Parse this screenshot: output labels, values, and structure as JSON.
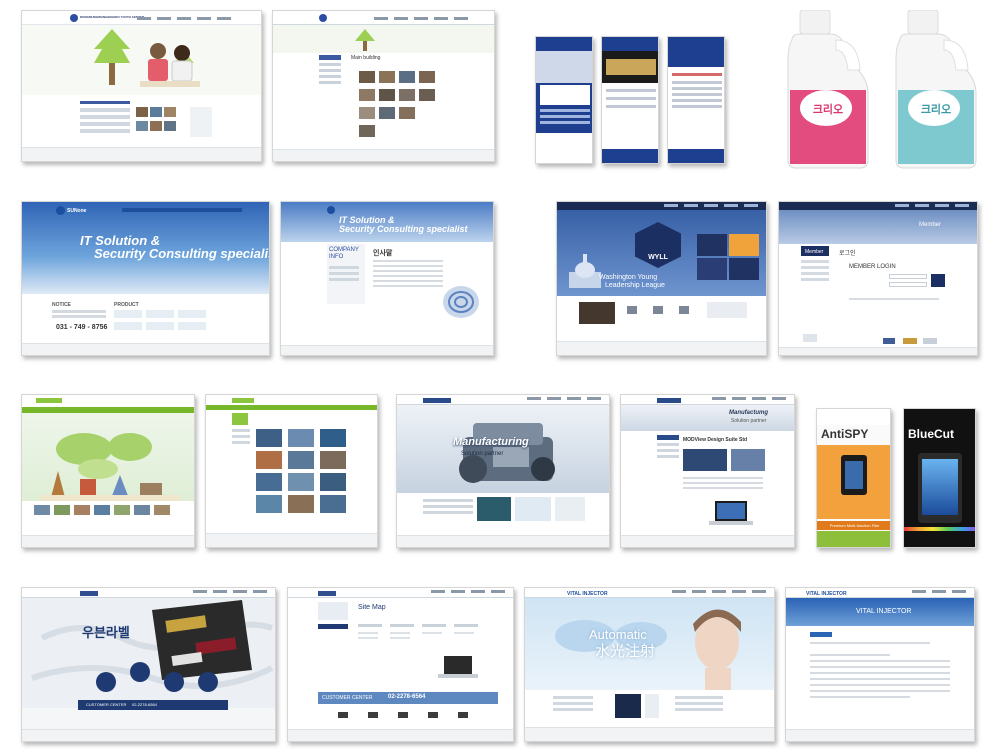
{
  "gallery": {
    "row1": {
      "youth_center_logo": "DONGMUNGWANGBOGIDO YOUTH CENTER",
      "main_building_title": "Main building",
      "laundry_label_pink": "크리오",
      "laundry_label_blue": "크리오"
    },
    "row2": {
      "sunone_logo": "SUNone",
      "it_headline_1": "IT Solution &",
      "it_headline_2": "Security Consulting specialist",
      "notice_label": "NOTICE",
      "product_label": "PRODUCT",
      "phone": "031 - 749 - 8756",
      "company_info_1": "COMPANY",
      "company_info_2": "INFO",
      "greeting": "인사말",
      "wyll_badge": "WYLL",
      "wyll_title_1": "Washington Young",
      "wyll_title_2": "Leadership League",
      "member_title": "Member",
      "login_kr": "로그인",
      "member_login": "MEMBER LOGIN"
    },
    "row3": {
      "manufacturing_1": "Manufacturing",
      "manufacturing_2": "Solution partner",
      "manufactumg_1": "Manufactumg",
      "manufactumg_2": "Solution partner",
      "modview": "MODView Design Suite Std",
      "antispy": "AntiSPY",
      "antispy_sub": "Premium Multi-function Film",
      "bluecut": "BlueCut"
    },
    "row4": {
      "brand_kr": "우븐라벨",
      "customer_center": "CUSTOMER CENTER",
      "phone_short": "02-2278-6564",
      "site_map": "Site Map",
      "customer_center_2": "CUSTOMER CENTER",
      "phone_2": "02-2278-6564",
      "vital_injector": "VITAL INJECTOR",
      "automatic": "Automatic",
      "vital_kr": "水光注射",
      "vital_injector_2": "VITAL INJECTOR"
    }
  }
}
